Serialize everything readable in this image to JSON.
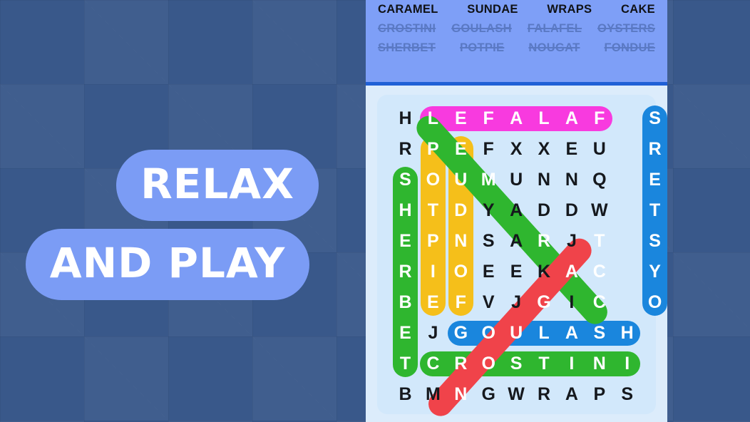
{
  "promo": {
    "line1": "RELAX",
    "line2": "AND PLAY"
  },
  "colors": {
    "background": "#39588a",
    "pill": "#7b9cf5",
    "panel": "#dcecfb",
    "wordbar": "#7e9ff7",
    "divider": "#1f60d6",
    "board": "#d2e8fb",
    "green": "#2fb62f",
    "yellow": "#f5bf1a",
    "blue": "#1a86dd",
    "pink": "#f83adf",
    "red": "#f0434a",
    "found_word": "#5a79c4"
  },
  "wordlist": {
    "rows": [
      [
        {
          "text": "CARAMEL",
          "found": false
        },
        {
          "text": "SUNDAE",
          "found": false
        },
        {
          "text": "WRAPS",
          "found": false
        },
        {
          "text": "CAKE",
          "found": false
        }
      ],
      [
        {
          "text": "CROSTINI",
          "found": true
        },
        {
          "text": "GOULASH",
          "found": true
        },
        {
          "text": "FALAFEL",
          "found": true
        },
        {
          "text": "OYSTERS",
          "found": true
        }
      ],
      [
        {
          "text": "SHERBET",
          "found": true
        },
        {
          "text": "POTPIE",
          "found": true
        },
        {
          "text": "NOUGAT",
          "found": true
        },
        {
          "text": "FONDUE",
          "found": true
        }
      ]
    ]
  },
  "grid": {
    "rows": 10,
    "cols": 10,
    "letters": [
      [
        "H",
        "L",
        "E",
        "F",
        "A",
        "L",
        "A",
        "F",
        "",
        "S"
      ],
      [
        "R",
        "P",
        "E",
        "F",
        "X",
        "X",
        "E",
        "U",
        "",
        "R"
      ],
      [
        "S",
        "O",
        "U",
        "M",
        "U",
        "N",
        "N",
        "Q",
        "",
        "E"
      ],
      [
        "H",
        "T",
        "D",
        "Y",
        "A",
        "D",
        "D",
        "W",
        "",
        "T"
      ],
      [
        "E",
        "P",
        "N",
        "S",
        "A",
        "R",
        "J",
        "T",
        "",
        "S"
      ],
      [
        "R",
        "I",
        "O",
        "E",
        "E",
        "K",
        "A",
        "C",
        "",
        "Y"
      ],
      [
        "B",
        "E",
        "F",
        "V",
        "J",
        "G",
        "I",
        "C",
        "",
        "O"
      ],
      [
        "E",
        "J",
        "G",
        "O",
        "U",
        "L",
        "A",
        "S",
        "H",
        ""
      ],
      [
        "T",
        "C",
        "R",
        "O",
        "S",
        "T",
        "I",
        "N",
        "I",
        ""
      ],
      [
        "B",
        "M",
        "N",
        "G",
        "W",
        "R",
        "A",
        "P",
        "S",
        ""
      ]
    ],
    "highlights": [
      {
        "word": "FALAFEL",
        "color": "#f83adf",
        "orientation": "horizontal-reversed",
        "row": 0,
        "col_start": 1,
        "col_end": 7
      },
      {
        "word": "SHERBET",
        "color": "#2fb62f",
        "orientation": "vertical",
        "col": 0,
        "row_start": 2,
        "row_end": 8
      },
      {
        "word": "POTPIE",
        "color": "#f5bf1a",
        "orientation": "vertical",
        "col": 1,
        "row_start": 1,
        "row_end": 6
      },
      {
        "word": "FONDUE",
        "color": "#f5bf1a",
        "orientation": "vertical-reversed",
        "col": 2,
        "row_start": 1,
        "row_end": 6
      },
      {
        "word": "OYSTERS",
        "color": "#1a86dd",
        "orientation": "vertical-reversed",
        "col": 9,
        "row_start": 0,
        "row_end": 6
      },
      {
        "word": "GOULASH",
        "color": "#1a86dd",
        "orientation": "horizontal",
        "row": 7,
        "col_start": 2,
        "col_end": 8
      },
      {
        "word": "CROSTINI",
        "color": "#2fb62f",
        "orientation": "horizontal",
        "row": 8,
        "col_start": 1,
        "col_end": 8
      },
      {
        "word": "CARAMEL",
        "color": "#2fb62f",
        "orientation": "diagonal-down-right-reversed",
        "row_start": 0,
        "col_start": 1,
        "row_end": 6,
        "col_end": 7
      },
      {
        "word": "NOUGAT",
        "color": "#f0434a",
        "orientation": "diagonal-down-left-reversed",
        "row_start": 4,
        "col_start": 7,
        "row_end": 9,
        "col_end": 2
      }
    ],
    "highlighted_cells": [
      "0-1",
      "0-2",
      "0-3",
      "0-4",
      "0-5",
      "0-6",
      "0-7",
      "1-1",
      "1-2",
      "2-0",
      "2-1",
      "2-2",
      "2-3",
      "3-0",
      "3-1",
      "3-2",
      "4-0",
      "4-1",
      "4-2",
      "4-5",
      "4-7",
      "5-0",
      "5-1",
      "5-2",
      "5-6",
      "5-7",
      "6-0",
      "6-1",
      "6-2",
      "6-5",
      "6-7",
      "7-0",
      "7-2",
      "7-3",
      "7-4",
      "7-5",
      "7-6",
      "7-7",
      "7-8",
      "8-0",
      "8-1",
      "8-2",
      "8-3",
      "8-4",
      "8-5",
      "8-6",
      "8-7",
      "8-8",
      "9-2",
      "0-9",
      "1-9",
      "2-9",
      "3-9",
      "4-9",
      "5-9",
      "6-9"
    ]
  }
}
